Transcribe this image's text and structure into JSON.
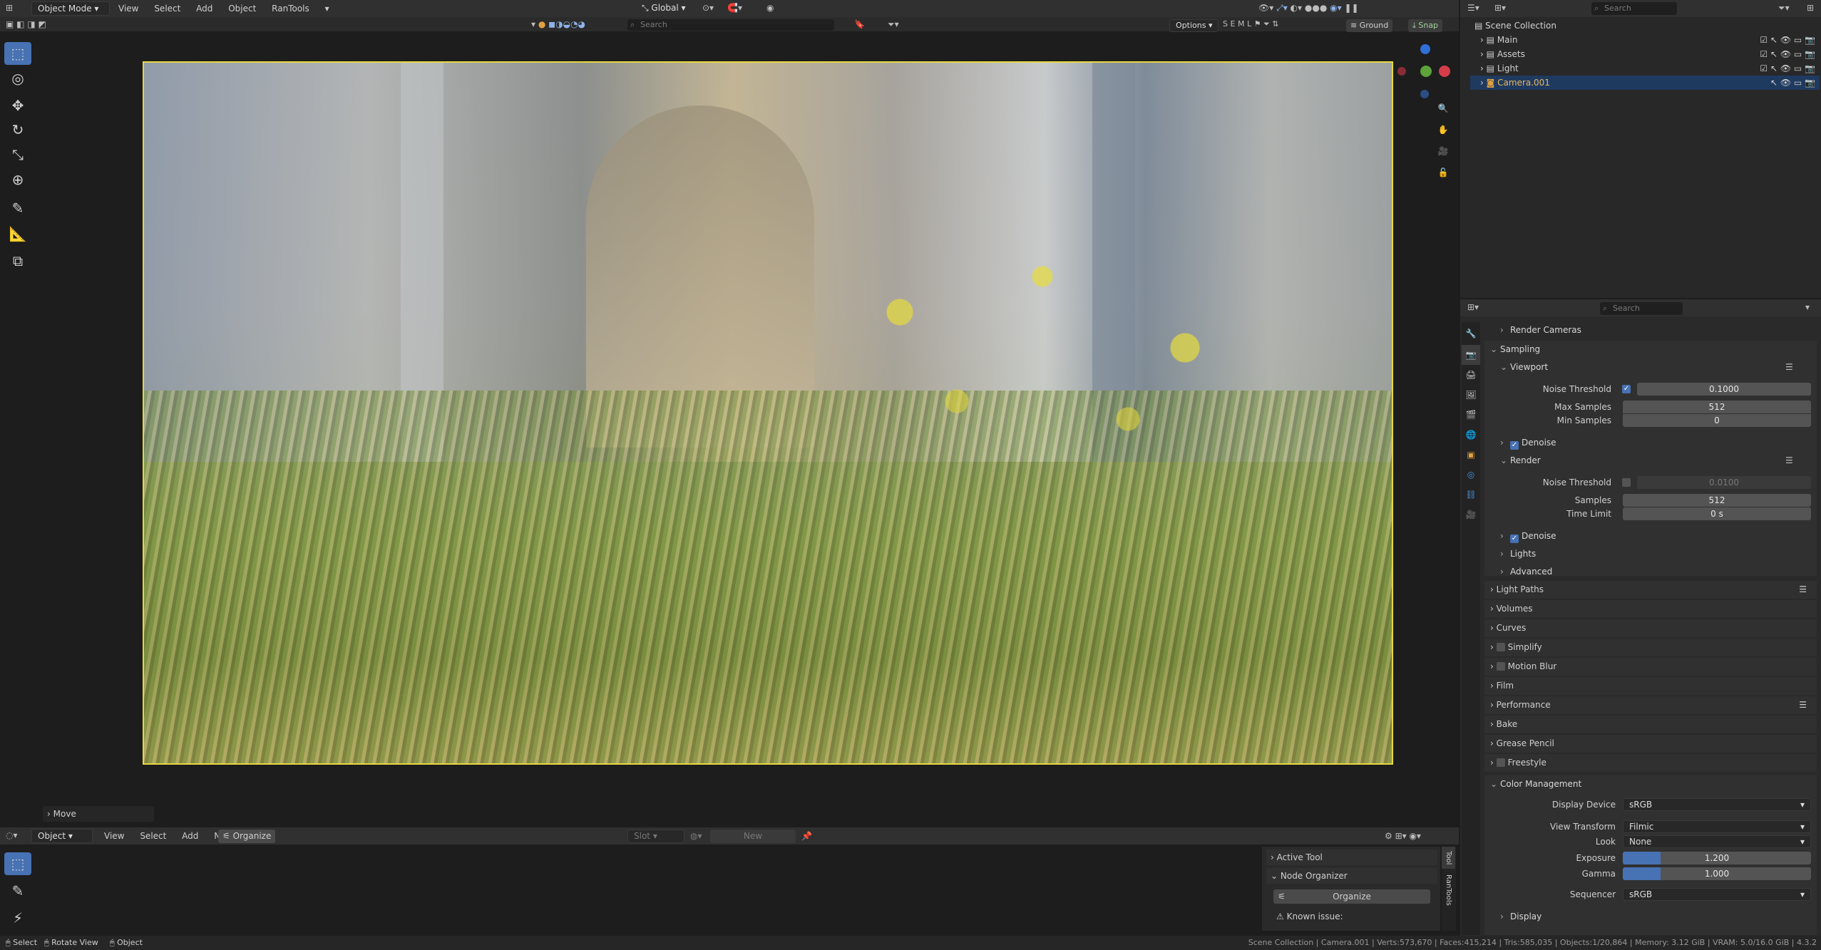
{
  "top_header": {
    "mode": "Object Mode",
    "menus": [
      "View",
      "Select",
      "Add",
      "Object",
      "RanTools"
    ],
    "transform_orientation": "Global",
    "search_placeholder": "Search",
    "options": "Options",
    "snap_target": "Ground",
    "snap": "Snap"
  },
  "viewport": {
    "last_operator": "Move"
  },
  "node_header": {
    "editor_type": "Object",
    "menus": [
      "View",
      "Select",
      "Add",
      "Node"
    ],
    "organize": "Organize",
    "slot": "Slot",
    "new": "New"
  },
  "node_sidebar": {
    "active_tool": "Active Tool",
    "node_organizer": "Node Organizer",
    "organize_button": "Organize",
    "known_issue": "Known issue:",
    "tabs": [
      "Tool",
      "RanTools"
    ]
  },
  "outliner": {
    "search_placeholder": "Search",
    "root": "Scene Collection",
    "items": [
      "Main",
      "Assets",
      "Light",
      "Camera.001"
    ]
  },
  "properties": {
    "search_placeholder": "Search",
    "render_cameras": "Render Cameras",
    "sampling": "Sampling",
    "viewport_label": "Viewport",
    "vp_noise_threshold_label": "Noise Threshold",
    "vp_noise_threshold": "0.1000",
    "vp_max_samples_label": "Max Samples",
    "vp_max_samples": "512",
    "vp_min_samples_label": "Min Samples",
    "vp_min_samples": "0",
    "vp_denoise": "Denoise",
    "render_label": "Render",
    "r_noise_threshold_label": "Noise Threshold",
    "r_noise_threshold": "0.0100",
    "r_samples_label": "Samples",
    "r_samples": "512",
    "r_time_limit_label": "Time Limit",
    "r_time_limit": "0 s",
    "r_denoise": "Denoise",
    "lights": "Lights",
    "advanced": "Advanced",
    "panels": [
      "Light Paths",
      "Volumes",
      "Curves",
      "Simplify",
      "Motion Blur",
      "Film",
      "Performance",
      "Bake",
      "Grease Pencil",
      "Freestyle"
    ],
    "color_management": "Color Management",
    "display_device_label": "Display Device",
    "display_device": "sRGB",
    "view_transform_label": "View Transform",
    "view_transform": "Filmic",
    "look_label": "Look",
    "look": "None",
    "exposure_label": "Exposure",
    "exposure": "1.200",
    "exposure_fill": 0.2,
    "gamma_label": "Gamma",
    "gamma": "1.000",
    "gamma_fill": 0.2,
    "sequencer_label": "Sequencer",
    "sequencer": "sRGB",
    "display": "Display"
  },
  "status_bar": {
    "select": "Select",
    "rotate_view": "Rotate View",
    "object": "Object",
    "info": "Scene Collection | Camera.001 | Verts:573,670 | Faces:415,214 | Tris:585,035 | Objects:1/20,864 | Memory: 3.12 GiB | VRAM: 5.0/16.0 GiB | 4.3.2"
  },
  "colors": {
    "accent": "#4772b3",
    "selected": "#1f3a5f",
    "camera_frame": "#e6d840",
    "header": "#303030",
    "panel": "#2a2a2a"
  }
}
